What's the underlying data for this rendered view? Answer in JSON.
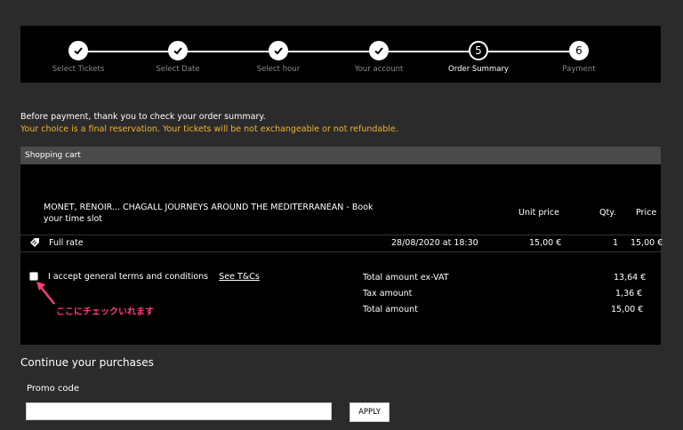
{
  "stepper": {
    "steps": [
      {
        "label": "Select Tickets",
        "state": "done",
        "number": ""
      },
      {
        "label": "Select Date",
        "state": "done",
        "number": ""
      },
      {
        "label": "Select hour",
        "state": "done",
        "number": ""
      },
      {
        "label": "Your account",
        "state": "done",
        "number": ""
      },
      {
        "label": "Order Summary",
        "state": "current",
        "number": "5"
      },
      {
        "label": "Payment",
        "state": "pending",
        "number": "6"
      }
    ]
  },
  "notices": {
    "line1": "Before payment, thank you to check your order summary.",
    "line2": "Your choice is a final reservation. Your tickets will be not exchangeable or not refundable."
  },
  "cart": {
    "header": "Shopping cart",
    "product_title": "MONET, RENOIR... CHAGALL JOURNEYS AROUND THE MEDITERRANEAN - Book your time slot",
    "columns": {
      "unit_price": "Unit price",
      "qty": "Qty.",
      "price": "Price"
    },
    "row": {
      "rate": "Full rate",
      "datetime": "28/08/2020 at 18:30",
      "unit_price": "15,00 €",
      "qty": "1",
      "price": "15,00 €"
    },
    "terms": {
      "label": "I accept general terms and conditions",
      "link": "See T&Cs"
    },
    "totals": [
      {
        "label": "Total amount ex-VAT",
        "value": "13,64 €"
      },
      {
        "label": "Tax amount",
        "value": "1,36 €"
      },
      {
        "label": "Total amount",
        "value": "15,00 €"
      }
    ]
  },
  "annotation": {
    "text": "ここにチェックいれます",
    "color": "#ff3d7f"
  },
  "continue": {
    "title": "Continue your purchases",
    "promo_label": "Promo code",
    "promo_value": "",
    "apply_label": "APPLY"
  },
  "colors": {
    "warning": "#f0b429",
    "background": "#2b2b2b",
    "panel": "#000000"
  }
}
